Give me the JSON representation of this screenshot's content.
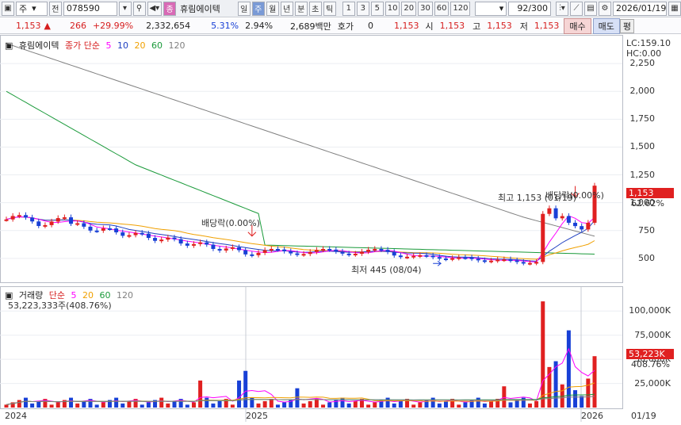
{
  "toolbar": {
    "market": "주",
    "prev_label": "전",
    "code": "078590",
    "stock_name": "휴림에이텍",
    "stock_prefix": "종",
    "periods": [
      "일",
      "주",
      "월",
      "년",
      "분",
      "초",
      "틱"
    ],
    "active_period": "주",
    "intervals": [
      "1",
      "3",
      "5",
      "10",
      "20",
      "30",
      "60",
      "120"
    ],
    "count": "92/300",
    "date": "2026/01/19"
  },
  "quote": {
    "price": "1,153",
    "arrow": "▲",
    "change": "266",
    "change_pct": "+29.99%",
    "volume": "2,332,654",
    "turnover_pct": "5.31%",
    "ratio": "2.94%",
    "amount": "2,689백만",
    "hoga_label": "호가",
    "hoga_value": "0",
    "bid": "1,153",
    "open_label": "시",
    "open": "1,153",
    "high_label": "고",
    "high": "1,153",
    "low_label": "저",
    "low": "1,153",
    "buy_label": "매수",
    "sell_label": "매도",
    "eval_label": "평"
  },
  "price_panel": {
    "title": "휴림에이텍",
    "ma_label": "종가 단순",
    "ma_periods": [
      "5",
      "10",
      "20",
      "60",
      "120"
    ],
    "lc": "LC:159.10",
    "hc": "HC:0.00",
    "current_tag": "1,153",
    "current_pct": "62.62%",
    "annotations": {
      "dividend1": "배당락(0.00%)",
      "dividend2": "배당락(0.00%)",
      "high": "최고 1,153 (01/19)",
      "low": "최저 445 (08/04)"
    }
  },
  "volume_panel": {
    "title": "거래량",
    "ma_label": "단순",
    "ma_periods": [
      "5",
      "20",
      "60",
      "120"
    ],
    "value": "53,223,333주(408.76%)",
    "current_tag": "53,223K",
    "current_pct": "408.76%"
  },
  "x_axis": {
    "labels": [
      "2024",
      "2025",
      "2026"
    ],
    "end_label": "01/19"
  },
  "chart_data": {
    "type": "candlestick",
    "y_ticks": [
      "2,250",
      "2,000",
      "1,750",
      "1,500",
      "1,250",
      "1,000",
      "750",
      "500"
    ],
    "y_range": [
      300,
      2450
    ],
    "volume_ticks": [
      "100,000K",
      "75,000K",
      "50,000K",
      "25,000K"
    ],
    "volume_range": [
      0,
      115000
    ],
    "colors": {
      "up": "#e02020",
      "down": "#1840d6",
      "ma5": "#ff00ff",
      "ma10": "#1f3fc0",
      "ma20": "#f0a000",
      "ma60": "#1a9a3a",
      "ma120": "#808080"
    }
  }
}
